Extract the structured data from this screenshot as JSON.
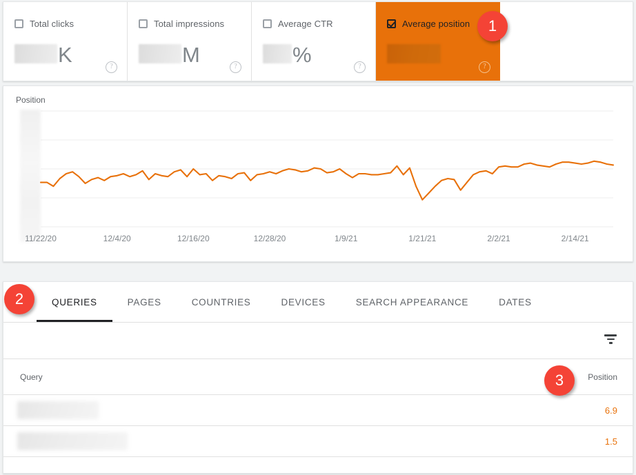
{
  "metric_cards": [
    {
      "label": "Total clicks",
      "unit": "K",
      "checked": false,
      "selected": false,
      "value_redacted": true,
      "help_icon": "help-circle-icon",
      "redacted_width": 62
    },
    {
      "label": "Total impressions",
      "unit": "M",
      "checked": false,
      "selected": false,
      "value_redacted": true,
      "help_icon": "help-circle-icon",
      "redacted_width": 62
    },
    {
      "label": "Average CTR",
      "unit": "%",
      "checked": false,
      "selected": false,
      "value_redacted": true,
      "help_icon": "help-circle-icon",
      "redacted_width": 42
    },
    {
      "label": "Average position",
      "unit": "",
      "checked": true,
      "selected": true,
      "value_redacted": true,
      "help_icon": "help-circle-icon",
      "redacted_width": 78
    }
  ],
  "chart": {
    "axis_title": "Position",
    "accent_color": "#e8710a",
    "y_labels_redacted": true
  },
  "chart_data": {
    "type": "line",
    "title": "Position",
    "xlabel": "",
    "ylabel": "Position",
    "grid": true,
    "legend": "none",
    "series_color": "#e8710a",
    "y_axis_inverted": true,
    "ylim": [
      14,
      2
    ],
    "tick_labels": [
      "11/22/20",
      "12/4/20",
      "12/16/20",
      "12/28/20",
      "1/9/21",
      "1/21/21",
      "2/2/21",
      "2/14/21"
    ],
    "x": [
      "11/22/20",
      "11/23/20",
      "11/24/20",
      "11/25/20",
      "11/26/20",
      "11/27/20",
      "11/28/20",
      "11/29/20",
      "11/30/20",
      "12/1/20",
      "12/2/20",
      "12/3/20",
      "12/4/20",
      "12/5/20",
      "12/6/20",
      "12/7/20",
      "12/8/20",
      "12/9/20",
      "12/10/20",
      "12/11/20",
      "12/12/20",
      "12/13/20",
      "12/14/20",
      "12/15/20",
      "12/16/20",
      "12/17/20",
      "12/18/20",
      "12/19/20",
      "12/20/20",
      "12/21/20",
      "12/22/20",
      "12/23/20",
      "12/24/20",
      "12/25/20",
      "12/26/20",
      "12/27/20",
      "12/28/20",
      "12/29/20",
      "12/30/20",
      "12/31/20",
      "1/1/21",
      "1/2/21",
      "1/3/21",
      "1/4/21",
      "1/5/21",
      "1/6/21",
      "1/7/21",
      "1/8/21",
      "1/9/21",
      "1/10/21",
      "1/11/21",
      "1/12/21",
      "1/13/21",
      "1/14/21",
      "1/15/21",
      "1/16/21",
      "1/17/21",
      "1/18/21",
      "1/19/21",
      "1/20/21",
      "1/21/21",
      "1/22/21",
      "1/23/21",
      "1/24/21",
      "1/25/21",
      "1/26/21",
      "1/27/21",
      "1/28/21",
      "1/29/21",
      "1/30/21",
      "1/31/21",
      "2/1/21",
      "2/2/21",
      "2/3/21",
      "2/4/21",
      "2/5/21",
      "2/6/21",
      "2/7/21",
      "2/8/21",
      "2/9/21",
      "2/10/21",
      "2/11/21",
      "2/12/21",
      "2/13/21",
      "2/14/21",
      "2/15/21",
      "2/16/21",
      "2/17/21",
      "2/18/21",
      "2/19/21",
      "2/20/21"
    ],
    "values": [
      9.4,
      9.4,
      9.8,
      9.0,
      8.5,
      8.3,
      8.8,
      9.5,
      9.1,
      8.9,
      9.2,
      8.8,
      8.7,
      8.5,
      8.8,
      8.6,
      8.2,
      9.1,
      8.5,
      8.7,
      8.8,
      8.3,
      8.1,
      8.8,
      8.0,
      8.6,
      8.5,
      9.2,
      8.7,
      8.8,
      9.0,
      8.5,
      8.4,
      9.2,
      8.6,
      8.5,
      8.3,
      8.5,
      8.2,
      8.0,
      8.1,
      8.3,
      8.2,
      7.9,
      8.0,
      8.4,
      8.3,
      8.0,
      8.5,
      8.9,
      8.5,
      8.5,
      8.6,
      8.6,
      8.5,
      8.4,
      7.7,
      8.6,
      7.9,
      9.8,
      11.2,
      10.5,
      9.8,
      9.2,
      9.0,
      9.1,
      10.2,
      9.4,
      8.6,
      8.3,
      8.2,
      8.5,
      7.8,
      7.7,
      7.8,
      7.8,
      7.5,
      7.4,
      7.6,
      7.7,
      7.8,
      7.5,
      7.3,
      7.3,
      7.4,
      7.5,
      7.4,
      7.2,
      7.3,
      7.5,
      7.6
    ]
  },
  "tabs": [
    {
      "label": "QUERIES",
      "active": true
    },
    {
      "label": "PAGES",
      "active": false
    },
    {
      "label": "COUNTRIES",
      "active": false
    },
    {
      "label": "DEVICES",
      "active": false
    },
    {
      "label": "SEARCH APPEARANCE",
      "active": false
    },
    {
      "label": "DATES",
      "active": false
    }
  ],
  "filter_icon": "filter-list-icon",
  "table": {
    "columns": [
      "Query",
      "Position"
    ],
    "rows": [
      {
        "query_redacted": true,
        "query_blur_width": 118,
        "position": "6.9"
      },
      {
        "query_redacted": true,
        "query_blur_width": 160,
        "position": "1.5"
      }
    ]
  },
  "badges": [
    {
      "number": "1"
    },
    {
      "number": "2"
    },
    {
      "number": "3"
    }
  ],
  "colors": {
    "accent": "#e8710a",
    "badge": "#f44336",
    "text_primary": "#202124",
    "text_secondary": "#5f6368"
  }
}
